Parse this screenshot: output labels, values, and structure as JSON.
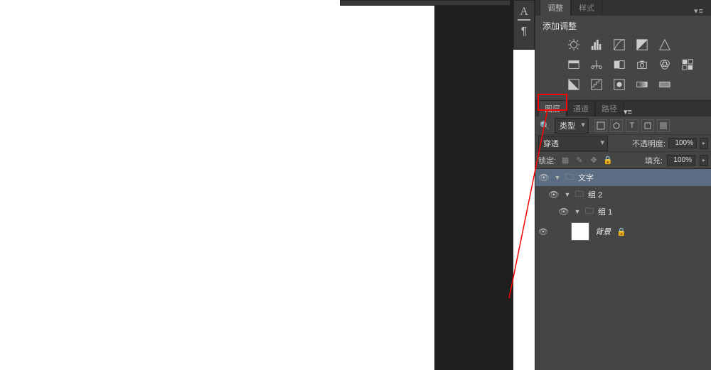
{
  "toolstrip": {
    "vertical_char_icon": "A",
    "paragraph_icon": "¶"
  },
  "adjustments": {
    "tab_adjust": "调整",
    "tab_styles": "样式",
    "add_label": "添加调整"
  },
  "layers": {
    "tab_layers": "图层",
    "tab_channels": "通道",
    "tab_paths": "路径",
    "kind_label": "类型",
    "blend_mode": "穿透",
    "opacity_label": "不透明度:",
    "opacity_value": "100%",
    "lock_label": "锁定:",
    "fill_label": "填充:",
    "fill_value": "100%",
    "rows": [
      {
        "name": "文字"
      },
      {
        "name": "组 2"
      },
      {
        "name": "组 1"
      }
    ],
    "background_name": "背景"
  }
}
